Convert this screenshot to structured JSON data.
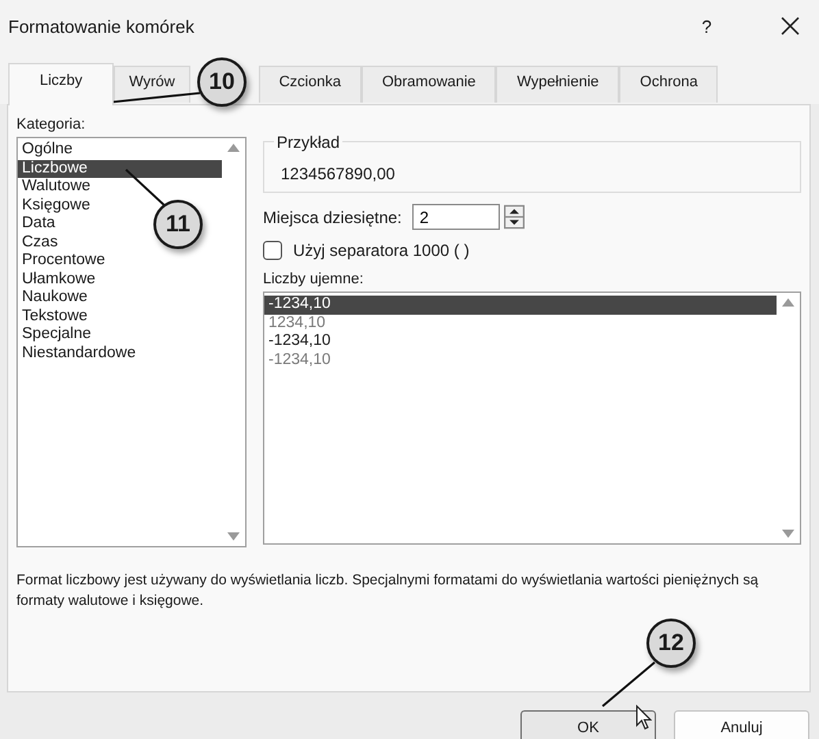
{
  "window": {
    "title": "Formatowanie komórek",
    "help": "?"
  },
  "tabs": [
    {
      "label": "Liczby",
      "selected": true
    },
    {
      "label": "Wyrów",
      "selected": false
    },
    {
      "label": "Czcionka",
      "selected": false
    },
    {
      "label": "Obramowanie",
      "selected": false
    },
    {
      "label": "Wypełnienie",
      "selected": false
    },
    {
      "label": "Ochrona",
      "selected": false
    }
  ],
  "category": {
    "label": "Kategoria:",
    "items": [
      {
        "label": "Ogólne",
        "selected": false
      },
      {
        "label": "Liczbowe",
        "selected": true
      },
      {
        "label": "Walutowe",
        "selected": false
      },
      {
        "label": "Księgowe",
        "selected": false
      },
      {
        "label": "Data",
        "selected": false
      },
      {
        "label": "Czas",
        "selected": false
      },
      {
        "label": "Procentowe",
        "selected": false
      },
      {
        "label": "Ułamkowe",
        "selected": false
      },
      {
        "label": "Naukowe",
        "selected": false
      },
      {
        "label": "Tekstowe",
        "selected": false
      },
      {
        "label": "Specjalne",
        "selected": false
      },
      {
        "label": "Niestandardowe",
        "selected": false
      }
    ]
  },
  "sample": {
    "label": "Przykład",
    "value": "1234567890,00"
  },
  "decimal_places": {
    "label": "Miejsca dziesiętne:",
    "value": "2"
  },
  "thousands_separator": {
    "label": "Użyj separatora 1000 ( )",
    "checked": false
  },
  "negative_numbers": {
    "label": "Liczby ujemne:",
    "items": [
      {
        "label": "-1234,10",
        "selected": true
      },
      {
        "label": "1234,10",
        "selected": false,
        "color": "#7a7a7a"
      },
      {
        "label": "-1234,10",
        "selected": false,
        "color": "#202020"
      },
      {
        "label": "-1234,10",
        "selected": false,
        "color": "#7a7a7a"
      }
    ]
  },
  "description": "Format liczbowy jest używany do wyświetlania liczb. Specjalnymi formatami do wyświetlania wartości pieniężnych są formaty walutowe i księgowe.",
  "buttons": [
    {
      "label": "OK",
      "default": true
    },
    {
      "label": "Anuluj",
      "default": false
    }
  ],
  "callouts": [
    {
      "number": "10"
    },
    {
      "number": "11"
    },
    {
      "number": "12"
    }
  ]
}
